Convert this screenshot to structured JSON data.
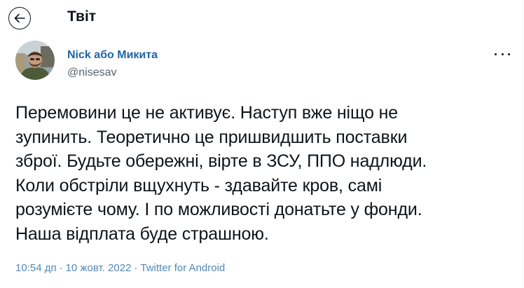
{
  "header": {
    "title": "Твіт",
    "back_icon": "arrow-left-icon"
  },
  "author": {
    "display_name": "Nick або Микита",
    "handle": "@nisesav"
  },
  "tweet": {
    "text": "Перемовини це не активує. Наступ вже ніщо не\nзупинить. Теоретично це пришвидшить поставки\nзброї. Будьте обережні, вірте в ЗСУ, ППО надлюди.\nКоли обстріли вщухнуть - здавайте кров, самі\nрозумієте чому. І по можливості донатьте у фонди.\nНаша відплата буде страшною.",
    "time": "10:54 дп",
    "date": "10 жовт. 2022",
    "source": "Twitter for Android",
    "separator": "·"
  },
  "colors": {
    "name": "#1d64a8",
    "meta": "#5388b5",
    "text": "#0f1419",
    "handle": "#536471"
  }
}
